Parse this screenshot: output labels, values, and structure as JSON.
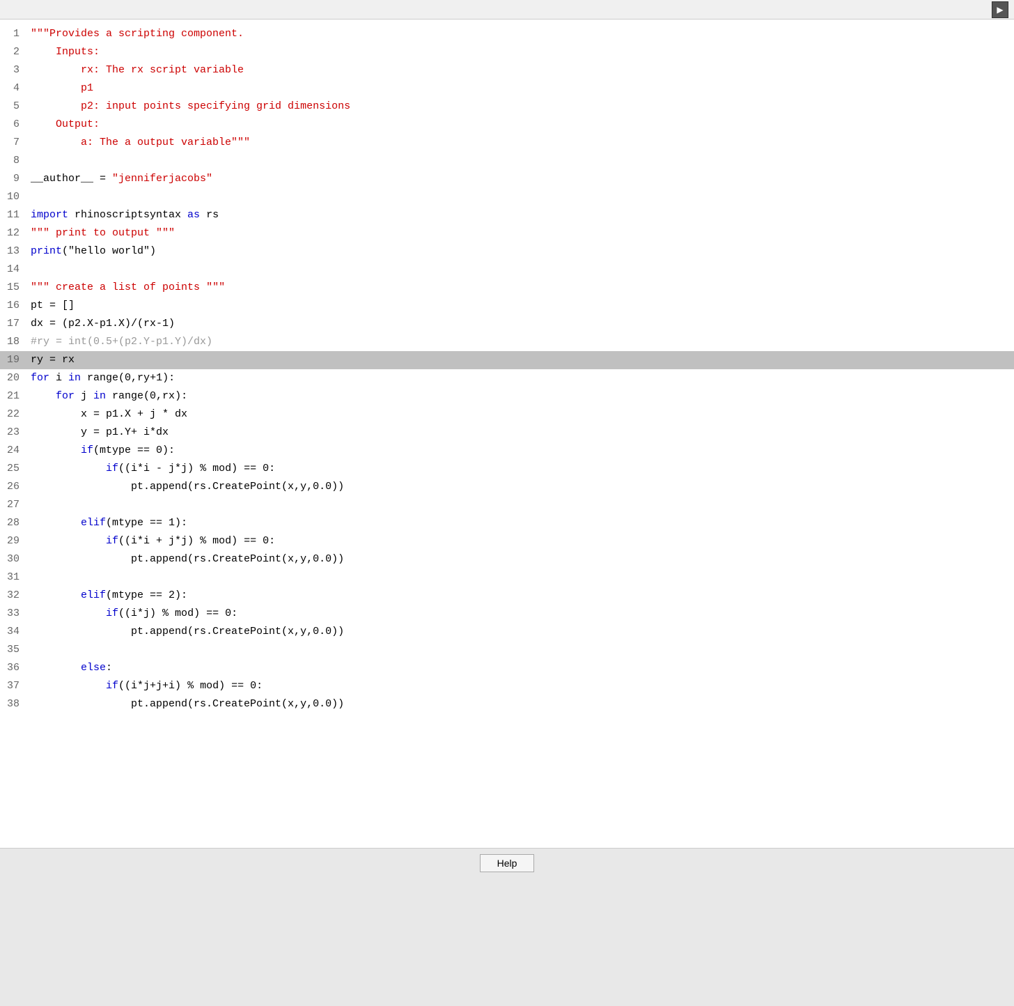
{
  "toolbar": {
    "run_label": "▶"
  },
  "help_button": {
    "label": "Help"
  },
  "code": {
    "lines": [
      {
        "num": 1,
        "tokens": [
          {
            "text": "\"\"\"Provides a scripting component.",
            "class": "c-red"
          }
        ]
      },
      {
        "num": 2,
        "tokens": [
          {
            "text": "    Inputs:",
            "class": "c-red"
          }
        ]
      },
      {
        "num": 3,
        "tokens": [
          {
            "text": "        rx: The rx script variable",
            "class": "c-red"
          }
        ]
      },
      {
        "num": 4,
        "tokens": [
          {
            "text": "        p1",
            "class": "c-red"
          }
        ]
      },
      {
        "num": 5,
        "tokens": [
          {
            "text": "        p2: input points specifying grid dimensions",
            "class": "c-red"
          }
        ]
      },
      {
        "num": 6,
        "tokens": [
          {
            "text": "    Output:",
            "class": "c-red"
          }
        ]
      },
      {
        "num": 7,
        "tokens": [
          {
            "text": "        a: The a output variable\"\"\"",
            "class": "c-red"
          }
        ]
      },
      {
        "num": 8,
        "tokens": []
      },
      {
        "num": 9,
        "tokens": [
          {
            "text": "__author__",
            "class": "c-black"
          },
          {
            "text": " = ",
            "class": "c-black"
          },
          {
            "text": "\"jenniferjacobs\"",
            "class": "c-red"
          }
        ]
      },
      {
        "num": 10,
        "tokens": []
      },
      {
        "num": 11,
        "tokens": [
          {
            "text": "import",
            "class": "c-blue"
          },
          {
            "text": " rhinoscriptsyntax ",
            "class": "c-black"
          },
          {
            "text": "as",
            "class": "c-blue"
          },
          {
            "text": " rs",
            "class": "c-black"
          }
        ]
      },
      {
        "num": 12,
        "tokens": [
          {
            "text": "\"\"\"",
            "class": "c-red"
          },
          {
            "text": " print to output ",
            "class": "c-red"
          },
          {
            "text": "\"\"\"",
            "class": "c-red"
          }
        ]
      },
      {
        "num": 13,
        "tokens": [
          {
            "text": "print",
            "class": "c-blue"
          },
          {
            "text": "(\"hello world\")",
            "class": "c-black"
          }
        ]
      },
      {
        "num": 14,
        "tokens": []
      },
      {
        "num": 15,
        "tokens": [
          {
            "text": "\"\"\"",
            "class": "c-red"
          },
          {
            "text": " create a list of points ",
            "class": "c-red"
          },
          {
            "text": "\"\"\"",
            "class": "c-red"
          }
        ]
      },
      {
        "num": 16,
        "tokens": [
          {
            "text": "pt = []",
            "class": "c-black"
          }
        ]
      },
      {
        "num": 17,
        "tokens": [
          {
            "text": "dx = (p2.X-p1.X)/(rx-1)",
            "class": "c-black"
          }
        ]
      },
      {
        "num": 18,
        "tokens": [
          {
            "text": "#ry = int(0.5+(p2.Y-p1.Y)/dx)",
            "class": "c-gray"
          }
        ]
      },
      {
        "num": 19,
        "tokens": [
          {
            "text": "ry = rx",
            "class": "c-black"
          }
        ],
        "highlighted": true
      },
      {
        "num": 20,
        "tokens": [
          {
            "text": "for",
            "class": "c-blue"
          },
          {
            "text": " i ",
            "class": "c-black"
          },
          {
            "text": "in",
            "class": "c-blue"
          },
          {
            "text": " range(0,ry+1):",
            "class": "c-black"
          }
        ]
      },
      {
        "num": 21,
        "tokens": [
          {
            "text": "    for",
            "class": "c-blue"
          },
          {
            "text": " j ",
            "class": "c-black"
          },
          {
            "text": "in",
            "class": "c-blue"
          },
          {
            "text": " range(0,rx):",
            "class": "c-black"
          }
        ]
      },
      {
        "num": 22,
        "tokens": [
          {
            "text": "        x = p1.X + j * dx",
            "class": "c-black"
          }
        ]
      },
      {
        "num": 23,
        "tokens": [
          {
            "text": "        y = p1.Y+ i*dx",
            "class": "c-black"
          }
        ]
      },
      {
        "num": 24,
        "tokens": [
          {
            "text": "        ",
            "class": "c-black"
          },
          {
            "text": "if",
            "class": "c-blue"
          },
          {
            "text": "(mtype == 0):",
            "class": "c-black"
          }
        ]
      },
      {
        "num": 25,
        "tokens": [
          {
            "text": "            ",
            "class": "c-black"
          },
          {
            "text": "if",
            "class": "c-blue"
          },
          {
            "text": "((i*i - j*j) % mod) == 0:",
            "class": "c-black"
          }
        ]
      },
      {
        "num": 26,
        "tokens": [
          {
            "text": "                pt.append(rs.CreatePoint(x,y,0.0))",
            "class": "c-black"
          }
        ]
      },
      {
        "num": 27,
        "tokens": []
      },
      {
        "num": 28,
        "tokens": [
          {
            "text": "        ",
            "class": "c-black"
          },
          {
            "text": "elif",
            "class": "c-blue"
          },
          {
            "text": "(mtype == 1):",
            "class": "c-black"
          }
        ]
      },
      {
        "num": 29,
        "tokens": [
          {
            "text": "            ",
            "class": "c-black"
          },
          {
            "text": "if",
            "class": "c-blue"
          },
          {
            "text": "((i*i + j*j) % mod) == 0:",
            "class": "c-black"
          }
        ]
      },
      {
        "num": 30,
        "tokens": [
          {
            "text": "                pt.append(rs.CreatePoint(x,y,0.0))",
            "class": "c-black"
          }
        ]
      },
      {
        "num": 31,
        "tokens": []
      },
      {
        "num": 32,
        "tokens": [
          {
            "text": "        ",
            "class": "c-black"
          },
          {
            "text": "elif",
            "class": "c-blue"
          },
          {
            "text": "(mtype == 2):",
            "class": "c-black"
          }
        ]
      },
      {
        "num": 33,
        "tokens": [
          {
            "text": "            ",
            "class": "c-black"
          },
          {
            "text": "if",
            "class": "c-blue"
          },
          {
            "text": "((i*j) % mod) == 0:",
            "class": "c-black"
          }
        ]
      },
      {
        "num": 34,
        "tokens": [
          {
            "text": "                pt.append(rs.CreatePoint(x,y,0.0))",
            "class": "c-black"
          }
        ]
      },
      {
        "num": 35,
        "tokens": []
      },
      {
        "num": 36,
        "tokens": [
          {
            "text": "        ",
            "class": "c-black"
          },
          {
            "text": "else",
            "class": "c-blue"
          },
          {
            "text": ":",
            "class": "c-black"
          }
        ]
      },
      {
        "num": 37,
        "tokens": [
          {
            "text": "            ",
            "class": "c-black"
          },
          {
            "text": "if",
            "class": "c-blue"
          },
          {
            "text": "((i*j+j+i) % mod) == 0:",
            "class": "c-black"
          }
        ]
      },
      {
        "num": 38,
        "tokens": [
          {
            "text": "                pt.append(rs.CreatePoint(x,y,0.0))",
            "class": "c-black"
          }
        ]
      }
    ]
  }
}
